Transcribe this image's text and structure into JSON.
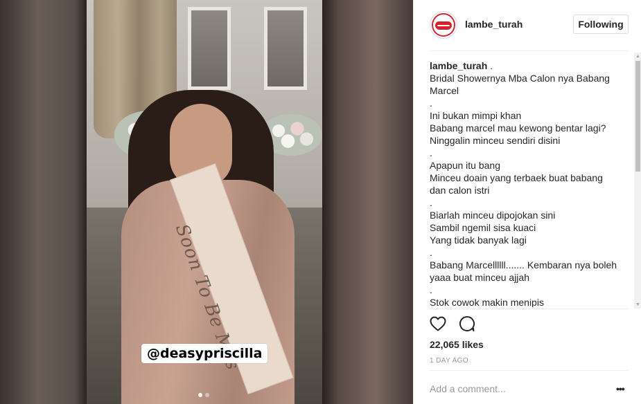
{
  "post": {
    "username": "lambe_turah",
    "follow_label": "Following",
    "caption_author": "lambe_turah",
    "caption_lines": [
      " .",
      "Bridal Showernya Mba Calon nya Babang",
      "Marcel",
      ".",
      "Ini bukan mimpi khan",
      "Babang marcel mau kewong bentar lagi?",
      "Ninggalin minceu sendiri disini",
      ".",
      "Apapun itu bang",
      "Minceu doain yang terbaek buat babang",
      "dan calon istri",
      ".",
      "Biarlah minceu dipojokan sini",
      "Sambil ngemil sisa kuaci",
      "Yang tidak banyak lagi",
      ".",
      "Babang Marcellllll....... Kembaran nya boleh",
      "yaaa buat minceu ajjah",
      ".",
      "Stok cowok makin menipis"
    ],
    "likes": "22,065 likes",
    "time_ago": "1 DAY AGO",
    "comment_placeholder": "Add a comment...",
    "more_label": "•••"
  },
  "media": {
    "tag_text": "@deasypriscilla",
    "sash_text": "Soon To Be Mrs",
    "carousel_count": 2,
    "carousel_active": 1
  },
  "icons": {
    "like": "heart-outline-icon",
    "comment": "speech-bubble-icon",
    "more": "ellipsis-icon"
  },
  "colors": {
    "brand_red": "#d81f2b",
    "text": "#262626",
    "muted": "#999999",
    "border": "#dbdbdb"
  }
}
